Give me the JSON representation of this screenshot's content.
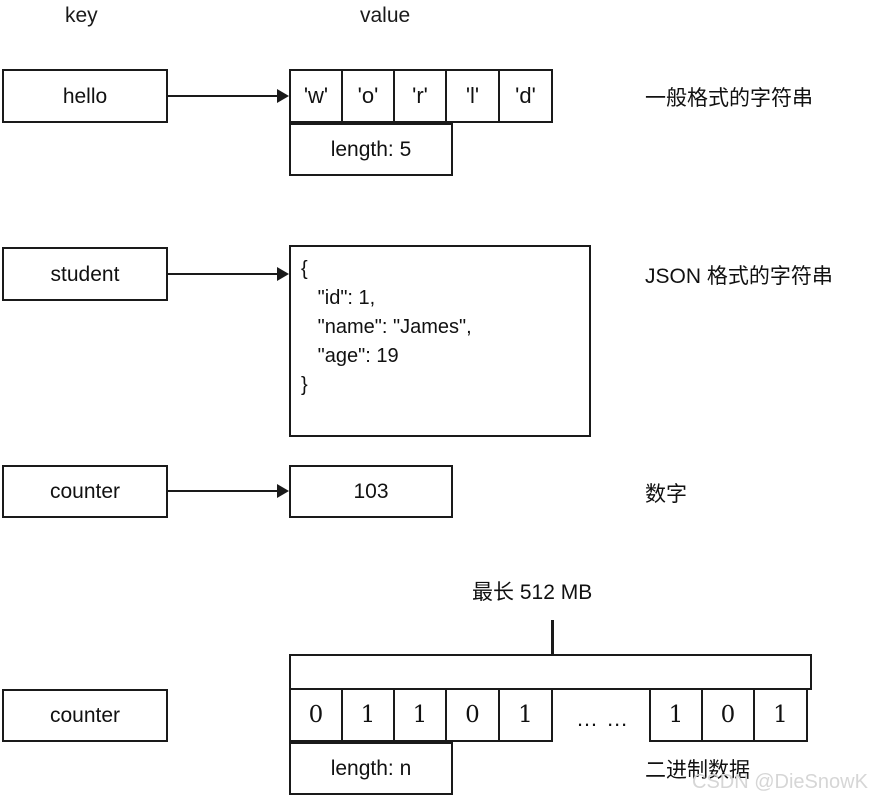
{
  "headers": {
    "key": "key",
    "value": "value"
  },
  "rows": [
    {
      "key": "hello",
      "chars": [
        "'w'",
        "'o'",
        "'r'",
        "'l'",
        "'d'"
      ],
      "length_label": "length: 5",
      "caption": "一般格式的字符串"
    },
    {
      "key": "student",
      "json_text": "{\n   \"id\": 1,\n   \"name\": \"James\",\n   \"age\": 19\n}",
      "caption": "JSON 格式的字符串"
    },
    {
      "key": "counter",
      "value": "103",
      "caption": "数字"
    },
    {
      "key": "counter",
      "size_note": "最长 512 MB",
      "bits_left": [
        "0",
        "1",
        "1",
        "0",
        "1"
      ],
      "ellipsis": "… …",
      "bits_right": [
        "1",
        "0",
        "1"
      ],
      "length_label": "length: n",
      "caption": "二进制数据"
    }
  ],
  "watermark": "CSDN @DieSnowK",
  "colors": {
    "stroke": "#1a1a1a",
    "text": "#111111",
    "background": "#ffffff",
    "watermark": "#d6d6d6"
  }
}
